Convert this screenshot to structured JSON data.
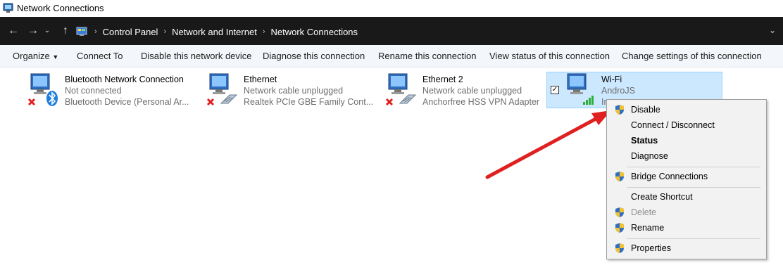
{
  "window": {
    "title": "Network Connections"
  },
  "address": {
    "crumbs": [
      "Control Panel",
      "Network and Internet",
      "Network Connections"
    ]
  },
  "toolbar": {
    "organize": "Organize",
    "connect_to": "Connect To",
    "disable_device": "Disable this network device",
    "diagnose": "Diagnose this connection",
    "rename": "Rename this connection",
    "view_status": "View status of this connection",
    "change_settings": "Change settings of this connection"
  },
  "connections": [
    {
      "name": "Bluetooth Network Connection",
      "status": "Not connected",
      "device": "Bluetooth Device (Personal Ar..."
    },
    {
      "name": "Ethernet",
      "status": "Network cable unplugged",
      "device": "Realtek PCIe GBE Family Cont..."
    },
    {
      "name": "Ethernet 2",
      "status": "Network cable unplugged",
      "device": "Anchorfree HSS VPN Adapter"
    },
    {
      "name": "Wi-Fi",
      "status": "AndroJS",
      "device": "In"
    }
  ],
  "context_menu": {
    "disable": "Disable",
    "connect": "Connect / Disconnect",
    "status": "Status",
    "diagnose": "Diagnose",
    "bridge": "Bridge Connections",
    "shortcut": "Create Shortcut",
    "delete": "Delete",
    "rename": "Rename",
    "properties": "Properties"
  },
  "colors": {
    "addressbar_bg": "#191919",
    "selection_bg": "#cce8ff",
    "arrow": "#e02020"
  }
}
